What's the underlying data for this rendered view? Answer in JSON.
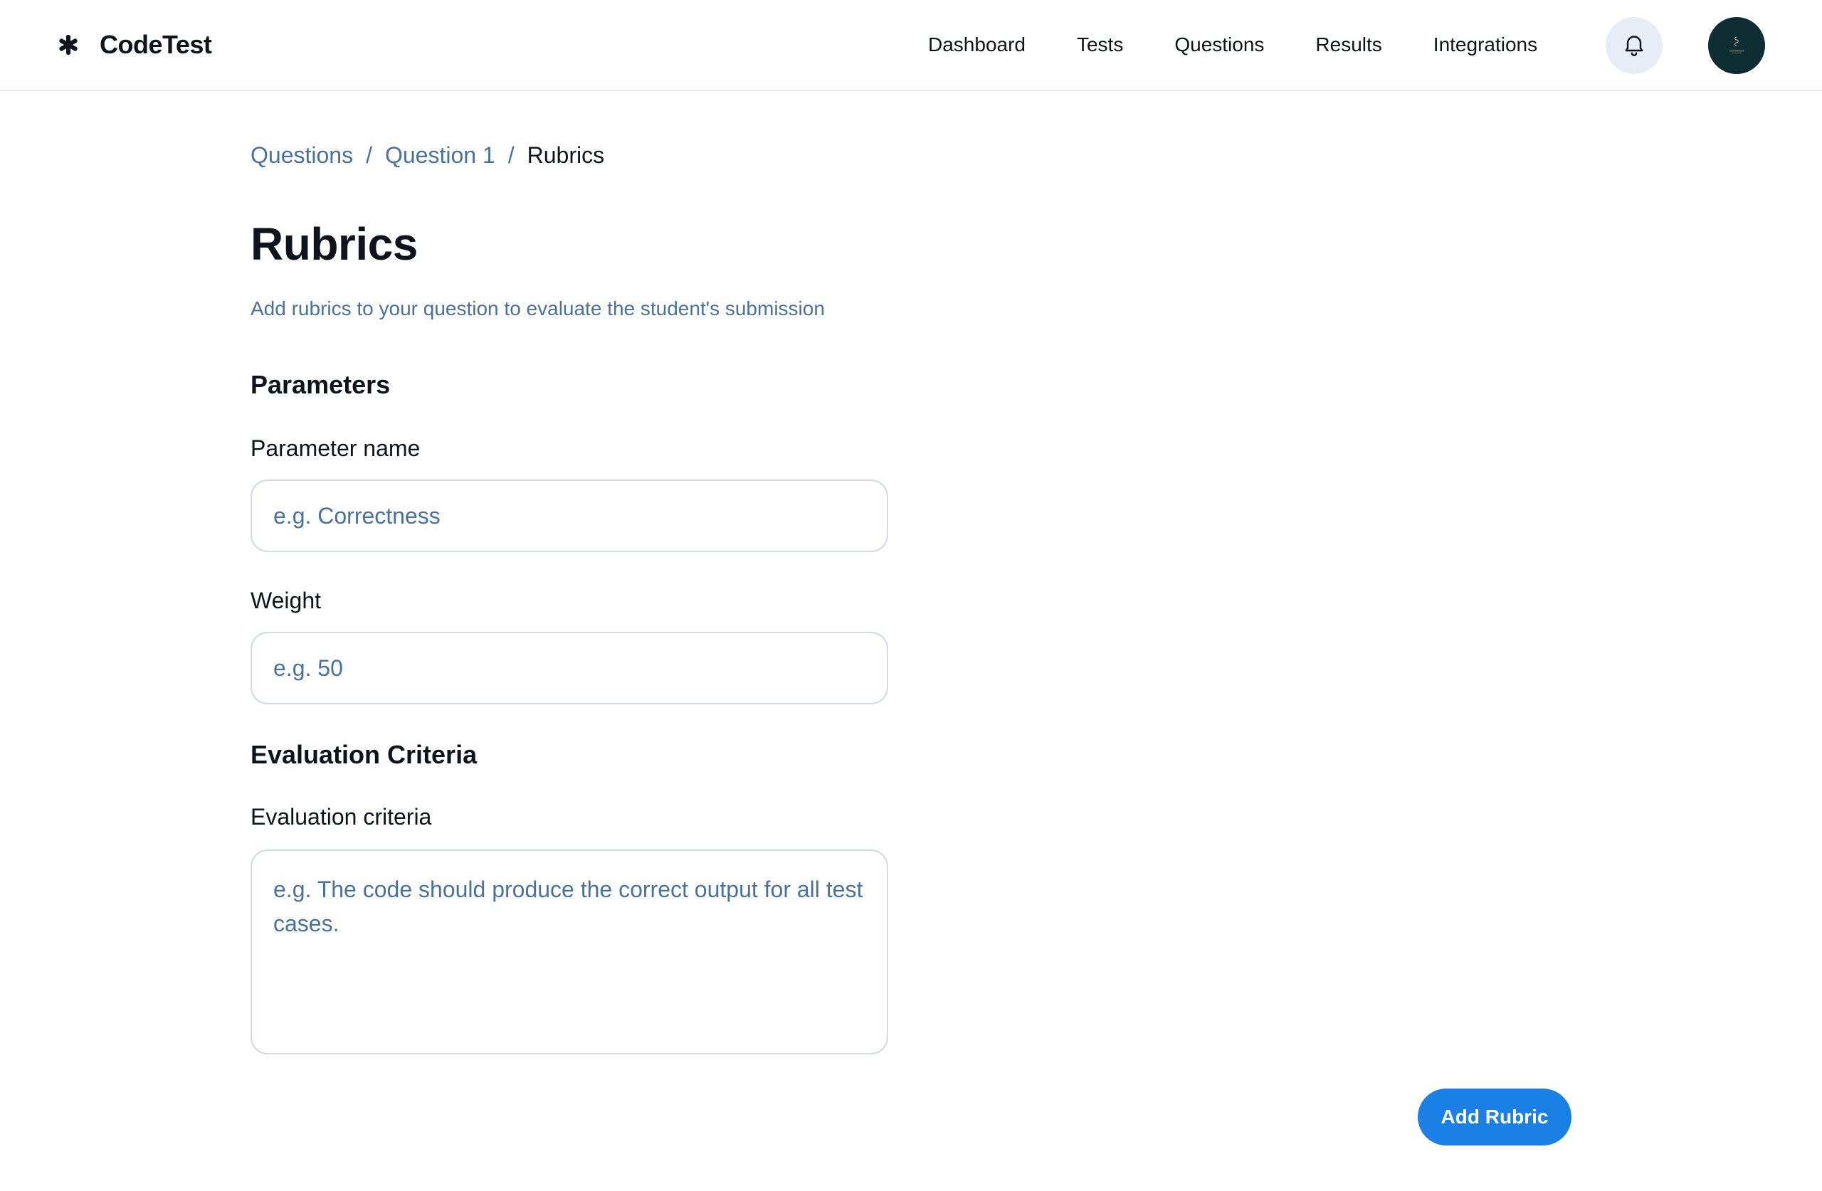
{
  "app": {
    "name": "CodeTest",
    "logo_icon": "asterisk-logo-icon"
  },
  "nav": {
    "items": [
      {
        "label": "Dashboard"
      },
      {
        "label": "Tests"
      },
      {
        "label": "Questions"
      },
      {
        "label": "Results"
      },
      {
        "label": "Integrations"
      }
    ],
    "notifications_icon": "bell-icon"
  },
  "breadcrumb": {
    "items": [
      {
        "label": "Questions"
      },
      {
        "label": "Question 1"
      }
    ],
    "separator": "/",
    "current": "Rubrics"
  },
  "page": {
    "title": "Rubrics",
    "subtitle": "Add rubrics to your question to evaluate the student's submission"
  },
  "parameters": {
    "heading": "Parameters",
    "name_label": "Parameter name",
    "name_placeholder": "e.g. Correctness",
    "name_value": "",
    "weight_label": "Weight",
    "weight_placeholder": "e.g. 50",
    "weight_value": ""
  },
  "evaluation": {
    "heading": "Evaluation Criteria",
    "criteria_label": "Evaluation criteria",
    "criteria_placeholder": "e.g. The code should produce the correct output for all test cases.",
    "criteria_value": ""
  },
  "actions": {
    "add_rubric_label": "Add Rubric"
  },
  "colors": {
    "primary": "#1a80e5",
    "muted_text": "#49719c",
    "border": "#cedbe8",
    "avatar_bg": "#0f2e33"
  }
}
